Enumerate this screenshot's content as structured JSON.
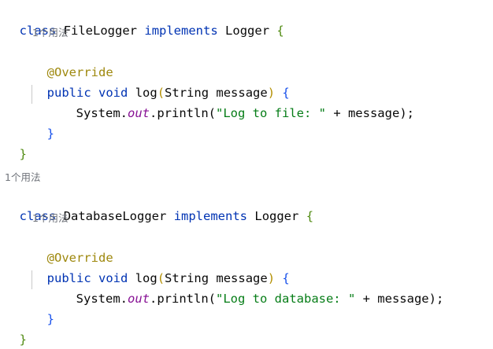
{
  "editor": {
    "block1": {
      "class_kw": "class",
      "class_name": "FileLogger",
      "implements_kw": "implements",
      "interface_name": "Logger",
      "open_brace": "{",
      "usage_hint": "1个用法",
      "annotation": "@Override",
      "public_kw": "public",
      "void_kw": "void",
      "method_name": "log",
      "param_open": "(",
      "param_type": "String",
      "param_name": "message",
      "param_close": ")",
      "method_open": "{",
      "stmt_system": "System.",
      "stmt_out": "out",
      "stmt_println": ".println(",
      "stmt_string": "\"Log to file: \"",
      "stmt_concat": " + message",
      "stmt_end": ");",
      "method_close": "}",
      "class_close": "}"
    },
    "class_usage_hint": "1个用法",
    "block2": {
      "class_kw": "class",
      "class_name": "DatabaseLogger",
      "implements_kw": "implements",
      "interface_name": "Logger",
      "open_brace": "{",
      "usage_hint": "1个用法",
      "annotation": "@Override",
      "public_kw": "public",
      "void_kw": "void",
      "method_name": "log",
      "param_open": "(",
      "param_type": "String",
      "param_name": "message",
      "param_close": ")",
      "method_open": "{",
      "stmt_system": "System.",
      "stmt_out": "out",
      "stmt_println": ".println(",
      "stmt_string": "\"Log to database: \"",
      "stmt_concat": " + message",
      "stmt_end": ");",
      "method_close": "}",
      "class_close": "}"
    }
  },
  "colors": {
    "keyword": "#0033b3",
    "annotation": "#9e880d",
    "string": "#067d17",
    "static_field": "#871094",
    "usage_hint": "#6f737a",
    "class_brace": "#4f8a10",
    "method_brace": "#1750eb"
  }
}
